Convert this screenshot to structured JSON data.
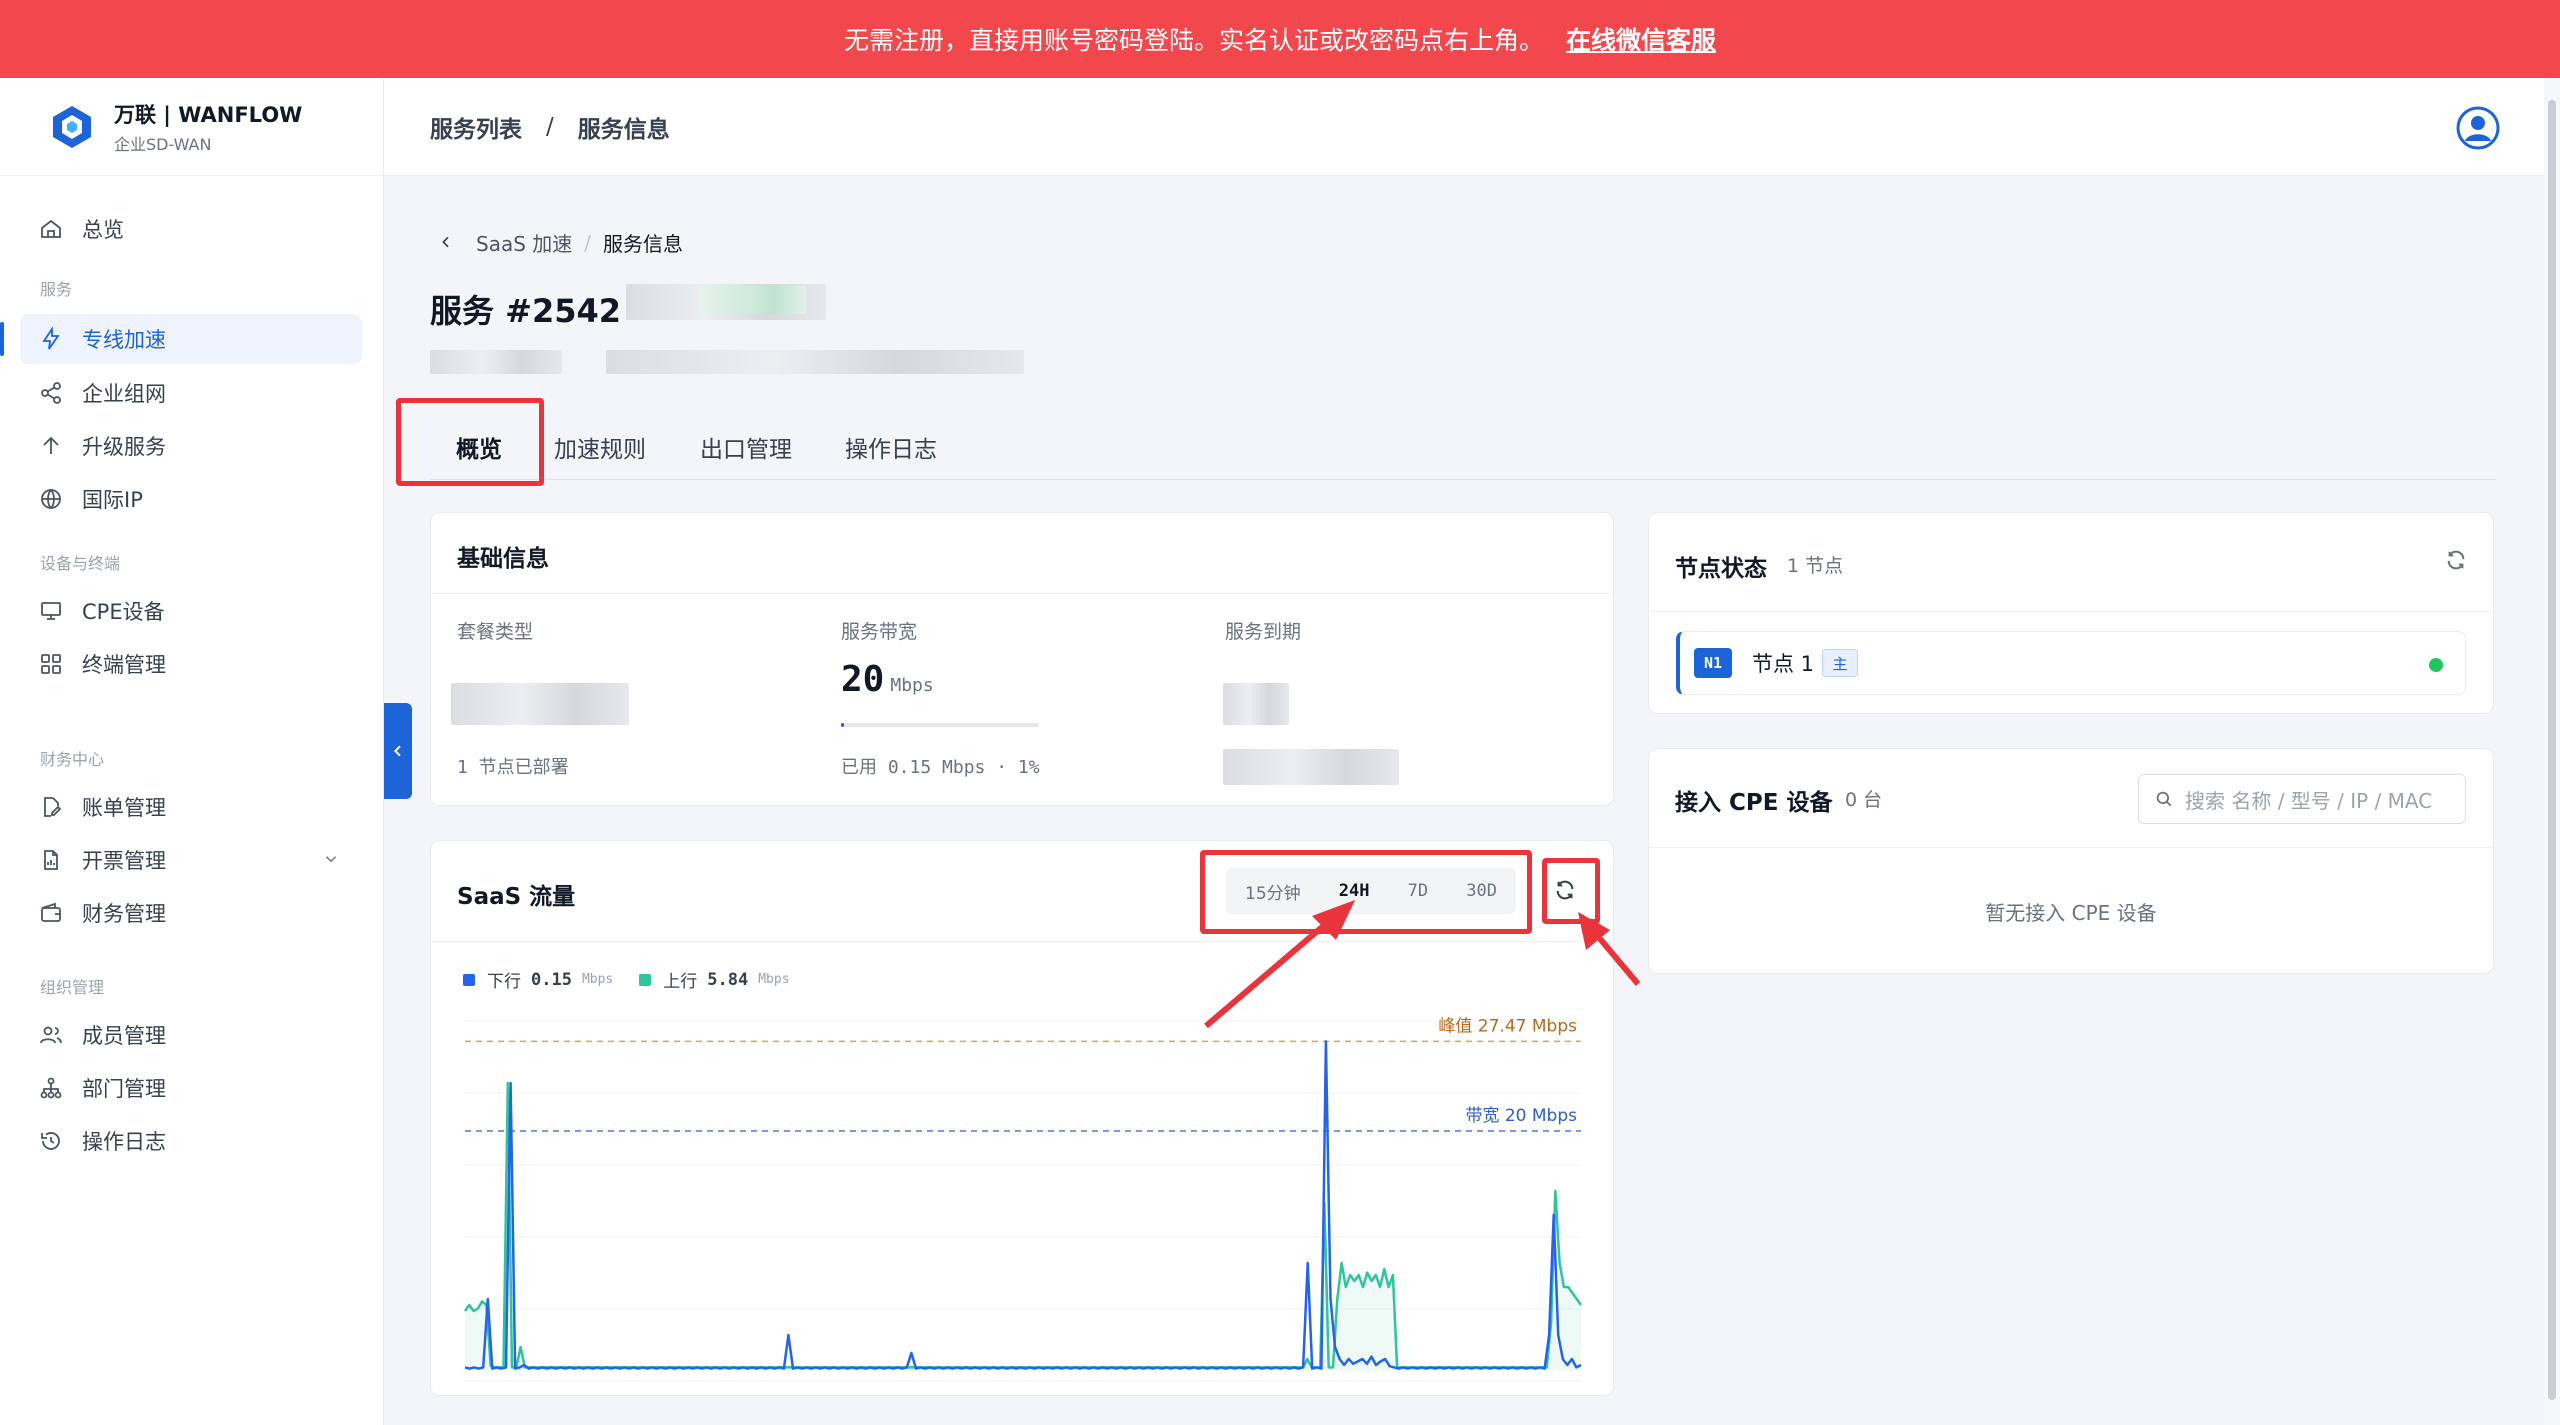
{
  "banner": {
    "text": "无需注册，直接用账号密码登陆。实名认证或改密码点右上角。",
    "link": "在线微信客服"
  },
  "brand": {
    "title": "万联 | WANFLOW",
    "subtitle": "企业SD-WAN"
  },
  "sidebar": {
    "overview": "总览",
    "group_service": "服务",
    "items_service": [
      "专线加速",
      "企业组网",
      "升级服务",
      "国际IP"
    ],
    "group_device": "设备与终端",
    "items_device": [
      "CPE设备",
      "终端管理"
    ],
    "group_finance": "财务中心",
    "items_finance": [
      "账单管理",
      "开票管理",
      "财务管理"
    ],
    "group_org": "组织管理",
    "items_org": [
      "成员管理",
      "部门管理",
      "操作日志"
    ],
    "active": "专线加速"
  },
  "header": {
    "crumb1": "服务列表",
    "sep": "/",
    "crumb2": "服务信息"
  },
  "subcrumb": {
    "parent": "SaaS 加速",
    "sep": "/",
    "current": "服务信息"
  },
  "page_title": "服务 #2542",
  "tabs": [
    "概览",
    "加速规则",
    "出口管理",
    "操作日志"
  ],
  "basic_info": {
    "title": "基础信息",
    "plan_label": "套餐类型",
    "plan_note": "1 节点已部署",
    "bandwidth_label": "服务带宽",
    "bandwidth_value": "20",
    "bandwidth_unit": "Mbps",
    "bandwidth_used": "已用 0.15 Mbps · 1%",
    "bandwidth_used_fraction": 0.01,
    "expiry_label": "服务到期"
  },
  "traffic": {
    "title": "SaaS 流量",
    "ranges": [
      "15分钟",
      "24H",
      "7D",
      "30D"
    ],
    "active_range": "24H",
    "down_label": "下行",
    "down_value": "0.15",
    "up_label": "上行",
    "up_value": "5.84",
    "unit": "Mbps",
    "peak_label": "峰值 27.47 Mbps",
    "bandwidth_line_label": "带宽 20 Mbps",
    "colors": {
      "down": "#2563eb",
      "up": "#2fc59a",
      "peak": "#e0a050",
      "bandwidth": "#4a78d8"
    }
  },
  "chart_data": {
    "type": "line",
    "ylim": [
      0,
      30
    ],
    "reference_lines": [
      {
        "label": "峰值 27.47 Mbps",
        "value": 27.47
      },
      {
        "label": "带宽 20 Mbps",
        "value": 20
      }
    ],
    "series": [
      {
        "name": "下行",
        "values": [
          0.3,
          0.2,
          0.3,
          0.2,
          0.3,
          6,
          0.2,
          0.3,
          0.2,
          0.3,
          24,
          0.2,
          0.3,
          0.5,
          0.2,
          0.3,
          0.2,
          0.3,
          0.2,
          0.3,
          0.2,
          0.3,
          0.2,
          0.3,
          0.2,
          0.3,
          0.2,
          0.3,
          0.2,
          0.3,
          0.2,
          0.3,
          0.2,
          0.3,
          0.2,
          0.3,
          0.2,
          0.3,
          0.2,
          0.3,
          0.2,
          0.3,
          0.2,
          0.3,
          0.2,
          0.3,
          0.2,
          0.3,
          0.2,
          0.3,
          0.2,
          0.3,
          0.2,
          0.3,
          0.2,
          0.3,
          0.2,
          0.3,
          0.2,
          0.3,
          0.2,
          0.3,
          0.2,
          0.3,
          0.2,
          0.3,
          0.2,
          0.3,
          0.2,
          0.3,
          0.2,
          3,
          0.2,
          0.3,
          0.2,
          0.3,
          0.2,
          0.3,
          0.2,
          0.3,
          0.2,
          0.3,
          0.2,
          0.3,
          0.2,
          0.3,
          0.2,
          0.3,
          0.2,
          0.3,
          0.2,
          0.3,
          0.2,
          0.3,
          0.2,
          0.3,
          0.2,
          0.3,
          1.5,
          0.2,
          0.3,
          0.2,
          0.3,
          0.2,
          0.3,
          0.2,
          0.3,
          0.2,
          0.3,
          0.2,
          0.3,
          0.2,
          0.3,
          0.2,
          0.3,
          0.2,
          0.3,
          0.2,
          0.3,
          0.2,
          0.3,
          0.2,
          0.3,
          0.2,
          0.3,
          0.2,
          0.3,
          0.2,
          0.3,
          0.2,
          0.3,
          0.2,
          0.3,
          0.2,
          0.3,
          0.2,
          0.3,
          0.2,
          0.3,
          0.2,
          0.3,
          0.2,
          0.3,
          0.2,
          0.3,
          0.2,
          0.3,
          0.2,
          0.3,
          0.2,
          0.3,
          0.2,
          0.3,
          0.2,
          0.3,
          0.2,
          0.3,
          0.2,
          0.3,
          0.2,
          0.3,
          0.2,
          0.3,
          0.2,
          0.3,
          0.2,
          0.3,
          0.2,
          0.3,
          0.2,
          0.3,
          0.2,
          0.3,
          0.2,
          0.3,
          0.2,
          0.3,
          0.2,
          0.3,
          0.2,
          0.3,
          0.2,
          0.3,
          0.2,
          0.3,
          9,
          0.2,
          0.3,
          0.2,
          27.47,
          6,
          2,
          1,
          0.5,
          1,
          0.6,
          0.8,
          1,
          0.6,
          1.2,
          0.5,
          0.8,
          1,
          0.4,
          0.3,
          0.2,
          0.3,
          0.2,
          0.3,
          0.2,
          0.3,
          0.2,
          0.3,
          0.2,
          0.3,
          0.2,
          0.3,
          0.2,
          0.3,
          0.2,
          0.3,
          0.2,
          0.3,
          0.2,
          0.3,
          0.2,
          0.3,
          0.2,
          0.3,
          0.2,
          0.3,
          0.2,
          0.3,
          0.2,
          0.3,
          0.2,
          0.3,
          0.2,
          3,
          13,
          3,
          1,
          0.5,
          1,
          0.3,
          0.5
        ]
      },
      {
        "name": "上行",
        "values": [
          5,
          5.5,
          5,
          5.2,
          5.8,
          5.5,
          0.4,
          0.3,
          0.3,
          0.3,
          24,
          0.3,
          0.3,
          2,
          0.3,
          0.3,
          0.3,
          0.3,
          0.3,
          0.3,
          0.3,
          0.3,
          0.3,
          0.3,
          0.3,
          0.3,
          0.3,
          0.3,
          0.3,
          0.3,
          0.3,
          0.3,
          0.3,
          0.3,
          0.3,
          0.3,
          0.3,
          0.3,
          0.3,
          0.3,
          0.3,
          0.3,
          0.3,
          0.3,
          0.3,
          0.3,
          0.3,
          0.3,
          0.3,
          0.3,
          0.3,
          0.3,
          0.3,
          0.3,
          0.3,
          0.3,
          0.3,
          0.3,
          0.3,
          0.3,
          0.3,
          0.3,
          0.3,
          0.3,
          0.3,
          0.3,
          0.3,
          0.3,
          0.3,
          0.3,
          0.3,
          0.3,
          0.3,
          0.3,
          0.3,
          0.3,
          0.3,
          0.3,
          0.3,
          0.3,
          0.3,
          0.3,
          0.3,
          0.3,
          0.3,
          0.3,
          0.3,
          0.3,
          0.3,
          0.3,
          0.3,
          0.3,
          0.3,
          0.3,
          0.3,
          0.3,
          0.3,
          0.3,
          0.3,
          0.3,
          0.3,
          0.3,
          0.3,
          0.3,
          0.3,
          0.3,
          0.3,
          0.3,
          0.3,
          0.3,
          0.3,
          0.3,
          0.3,
          0.3,
          0.3,
          0.3,
          0.3,
          0.3,
          0.3,
          0.3,
          0.3,
          0.3,
          0.3,
          0.3,
          0.3,
          0.3,
          0.3,
          0.3,
          0.3,
          0.3,
          0.3,
          0.3,
          0.3,
          0.3,
          0.3,
          0.3,
          0.3,
          0.3,
          0.3,
          0.3,
          0.3,
          0.3,
          0.3,
          0.3,
          0.3,
          0.3,
          0.3,
          0.3,
          0.3,
          0.3,
          0.3,
          0.3,
          0.3,
          0.3,
          0.3,
          0.3,
          0.3,
          0.3,
          0.3,
          0.3,
          0.3,
          0.3,
          0.3,
          0.3,
          0.3,
          0.3,
          0.3,
          0.3,
          0.3,
          0.3,
          0.3,
          0.3,
          0.3,
          0.3,
          0.3,
          0.3,
          0.3,
          0.3,
          0.3,
          0.3,
          0.3,
          0.3,
          0.3,
          0.3,
          0.3,
          0.3,
          0.3,
          0.3,
          0.3,
          0.3,
          0.3,
          0.3,
          0.3,
          0.3,
          0.3,
          0.3,
          0.3,
          1,
          0.3,
          0.3,
          0.3,
          14,
          0.3,
          0.3,
          6,
          9,
          7,
          8,
          7.5,
          8,
          7,
          8.2,
          7.5,
          8,
          7,
          8.5,
          7,
          8,
          0.3,
          0.3,
          0.3,
          0.3,
          0.3,
          0.3,
          0.3,
          0.3,
          0.3,
          0.3,
          0.3,
          0.3,
          0.3,
          0.3,
          0.3,
          0.3,
          0.3,
          0.3,
          0.3,
          0.3,
          0.3,
          0.3,
          0.3,
          0.3,
          0.3,
          0.3,
          0.3,
          0.3,
          0.3,
          0.3,
          0.3,
          0.3,
          0.3,
          0.3,
          0.3,
          0.3,
          4,
          15,
          9,
          7,
          7,
          6.5,
          6,
          5.5
        ]
      }
    ]
  },
  "node_status": {
    "title": "节点状态",
    "count": "1 节点",
    "node_badge": "N1",
    "node_name": "节点 1",
    "node_tag": "主"
  },
  "cpe": {
    "title": "接入 CPE 设备",
    "count": "0 台",
    "search_placeholder": "搜索 名称 / 型号 / IP / MAC",
    "empty": "暂无接入 CPE 设备"
  }
}
